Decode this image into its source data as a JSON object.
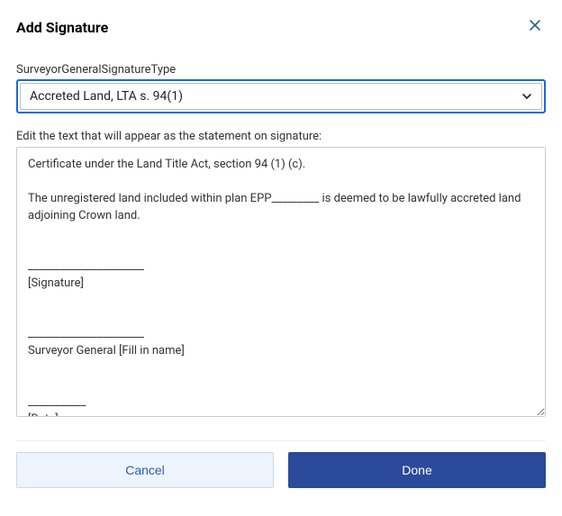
{
  "dialog": {
    "title": "Add Signature"
  },
  "signatureType": {
    "label": "SurveyorGeneralSignatureType",
    "selected": "Accreted Land, LTA s. 94(1)"
  },
  "statement": {
    "instruction": "Edit the text that will appear as the statement on signature:",
    "value": "Certificate under the Land Title Act, section 94 (1) (c).\n\nThe unregistered land included within plan EPP_________ is deemed to be lawfully accreted land adjoining Crown land.\n\n\n______________________\n[Signature]\n\n\n______________________\nSurveyor General [Fill in name]\n\n\n___________\n[Date]"
  },
  "buttons": {
    "cancel": "Cancel",
    "done": "Done"
  }
}
